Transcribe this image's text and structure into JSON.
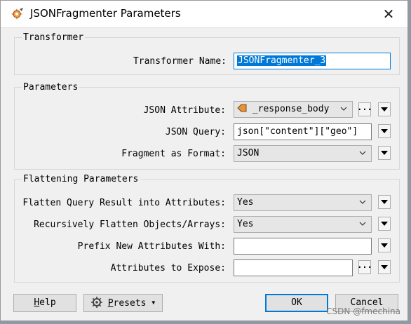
{
  "window": {
    "title": "JSONFragmenter Parameters",
    "close_label": "✕"
  },
  "transformer": {
    "group_title": "Transformer",
    "name_label": "Transformer Name:",
    "name_value": "JSONFragmenter_3"
  },
  "parameters": {
    "group_title": "Parameters",
    "json_attribute_label": "JSON Attribute:",
    "json_attribute_value": "_response_body",
    "json_query_label": "JSON Query:",
    "json_query_value": "json[\"content\"][\"geo\"]",
    "fragment_format_label": "Fragment as Format:",
    "fragment_format_value": "JSON"
  },
  "flattening": {
    "group_title": "Flattening Parameters",
    "flatten_query_label": "Flatten Query Result into Attributes:",
    "flatten_query_value": "Yes",
    "recursive_label": "Recursively Flatten Objects/Arrays:",
    "recursive_value": "Yes",
    "prefix_label": "Prefix New Attributes With:",
    "prefix_value": "",
    "expose_label": "Attributes to Expose:",
    "expose_value": ""
  },
  "buttons": {
    "help_first": "H",
    "help_rest": "elp",
    "presets_first": "P",
    "presets_rest": "resets",
    "ok": "OK",
    "cancel": "Cancel"
  },
  "watermark": "CSDN @fmechina",
  "icons": {
    "app": "transformer-gear-icon",
    "attribute": "attribute-tag-icon",
    "presets": "gear-icon"
  },
  "colors": {
    "accent": "#0078d7",
    "background": "#f0f0f0"
  }
}
